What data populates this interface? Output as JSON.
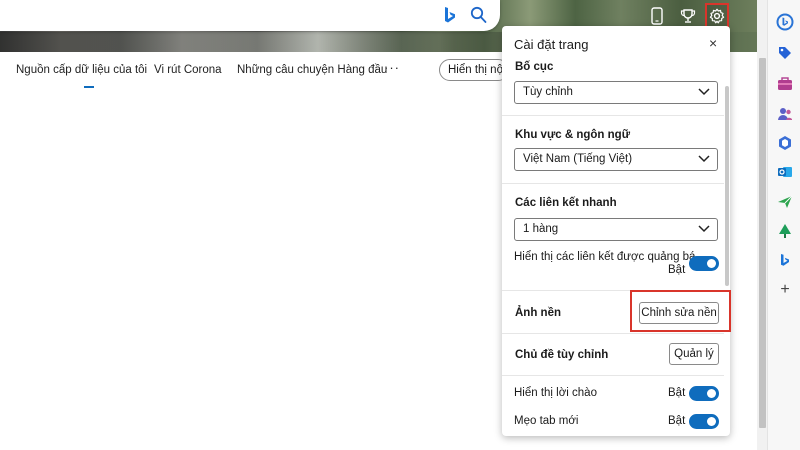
{
  "nav": {
    "items": [
      "Nguồn cấp dữ liệu của tôi",
      "Vi rút Corona",
      "Những câu chuyện Hàng đầu"
    ],
    "more": "···",
    "show_button": "Hiển thị nội dung"
  },
  "panel": {
    "title": "Cài đặt trang",
    "close": "×",
    "layout_label": "Bố cục",
    "layout_value": "Tùy chỉnh",
    "region_label": "Khu vực & ngôn ngữ",
    "region_value": "Việt Nam (Tiếng Việt)",
    "quicklinks_label": "Các liên kết nhanh",
    "quicklinks_value": "1 hàng",
    "promoted_links_label": "Hiển thị các liên kết được quảng bá",
    "promoted_links_state": "Bật",
    "background_label": "Ảnh nền",
    "edit_background": "Chỉnh sửa nền",
    "custom_theme_label": "Chủ đề tùy chỉnh",
    "manage": "Quản lý",
    "greeting_label": "Hiển thị lời chào",
    "greeting_state": "Bật",
    "tips_label": "Mẹo tab mới",
    "tips_state": "Bật"
  },
  "sidebar": {
    "icons": [
      "bing-chat-icon",
      "tag-icon",
      "briefcase-icon",
      "people-icon",
      "office-icon",
      "outlook-icon",
      "send-icon",
      "tree-icon",
      "bing-icon",
      "add-icon"
    ],
    "add": "+"
  },
  "colors": {
    "accent": "#0f6cbd",
    "highlight": "#d9352b"
  }
}
